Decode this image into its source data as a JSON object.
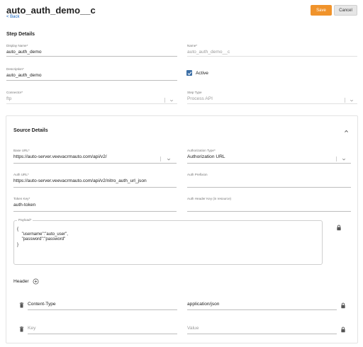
{
  "page": {
    "title": "auto_auth_demo__c",
    "back_label": "< Back",
    "save_label": "Save",
    "cancel_label": "Cancel"
  },
  "colors": {
    "save_bg": "#f0932b",
    "checkbox": "#3b6ea5",
    "back_link": "#1565c0"
  },
  "step_details": {
    "heading": "Step Details",
    "display_name": {
      "label": "Display Name*",
      "value": "auto_auth_demo"
    },
    "name": {
      "label": "Name*",
      "value": "auto_auth_demo__c"
    },
    "description": {
      "label": "Description*",
      "value": "auto_auth_demo"
    },
    "active": {
      "label": "Active",
      "checked": true
    },
    "connector": {
      "label": "Connector*",
      "value": "ftp"
    },
    "step_type": {
      "label": "Step Type",
      "value": "Process API"
    }
  },
  "source_details": {
    "heading": "Source Details",
    "base_url": {
      "label": "Base URL*",
      "value": "https://auto-server.veevacrmauto.com/api/v2/"
    },
    "authorization_type": {
      "label": "Authorization Type*",
      "value": "Authorization URL"
    },
    "auth_url": {
      "label": "Auth URL*",
      "value": "https://auto-server.veevacrmauto.com/api/v2/nitro_auth_url_json"
    },
    "auth_prefix": {
      "label": "Auth Prefixion",
      "value": ""
    },
    "token_key": {
      "label": "Token Key*",
      "value": "auth-token"
    },
    "auth_header_key": {
      "label": "Auth Header Key (in resource)",
      "value": ""
    },
    "payload": {
      "label": "Payload*",
      "value": "{\n    \"username\":\"auto_user\",\n    \"password\":\"password\"\n}"
    },
    "header": {
      "label": "Header",
      "rows": [
        {
          "key": "Content-Type",
          "value": "application/json",
          "key_placeholder": "Key",
          "value_placeholder": "Value"
        },
        {
          "key": "",
          "value": "",
          "key_placeholder": "Key",
          "value_placeholder": "Value"
        }
      ]
    }
  },
  "icons": {
    "chevron_down": "chevron-down-icon",
    "chevron_up": "chevron-up-icon",
    "lock": "lock-icon",
    "trash": "trash-icon",
    "add": "add-circle-icon",
    "check": "check-icon"
  }
}
